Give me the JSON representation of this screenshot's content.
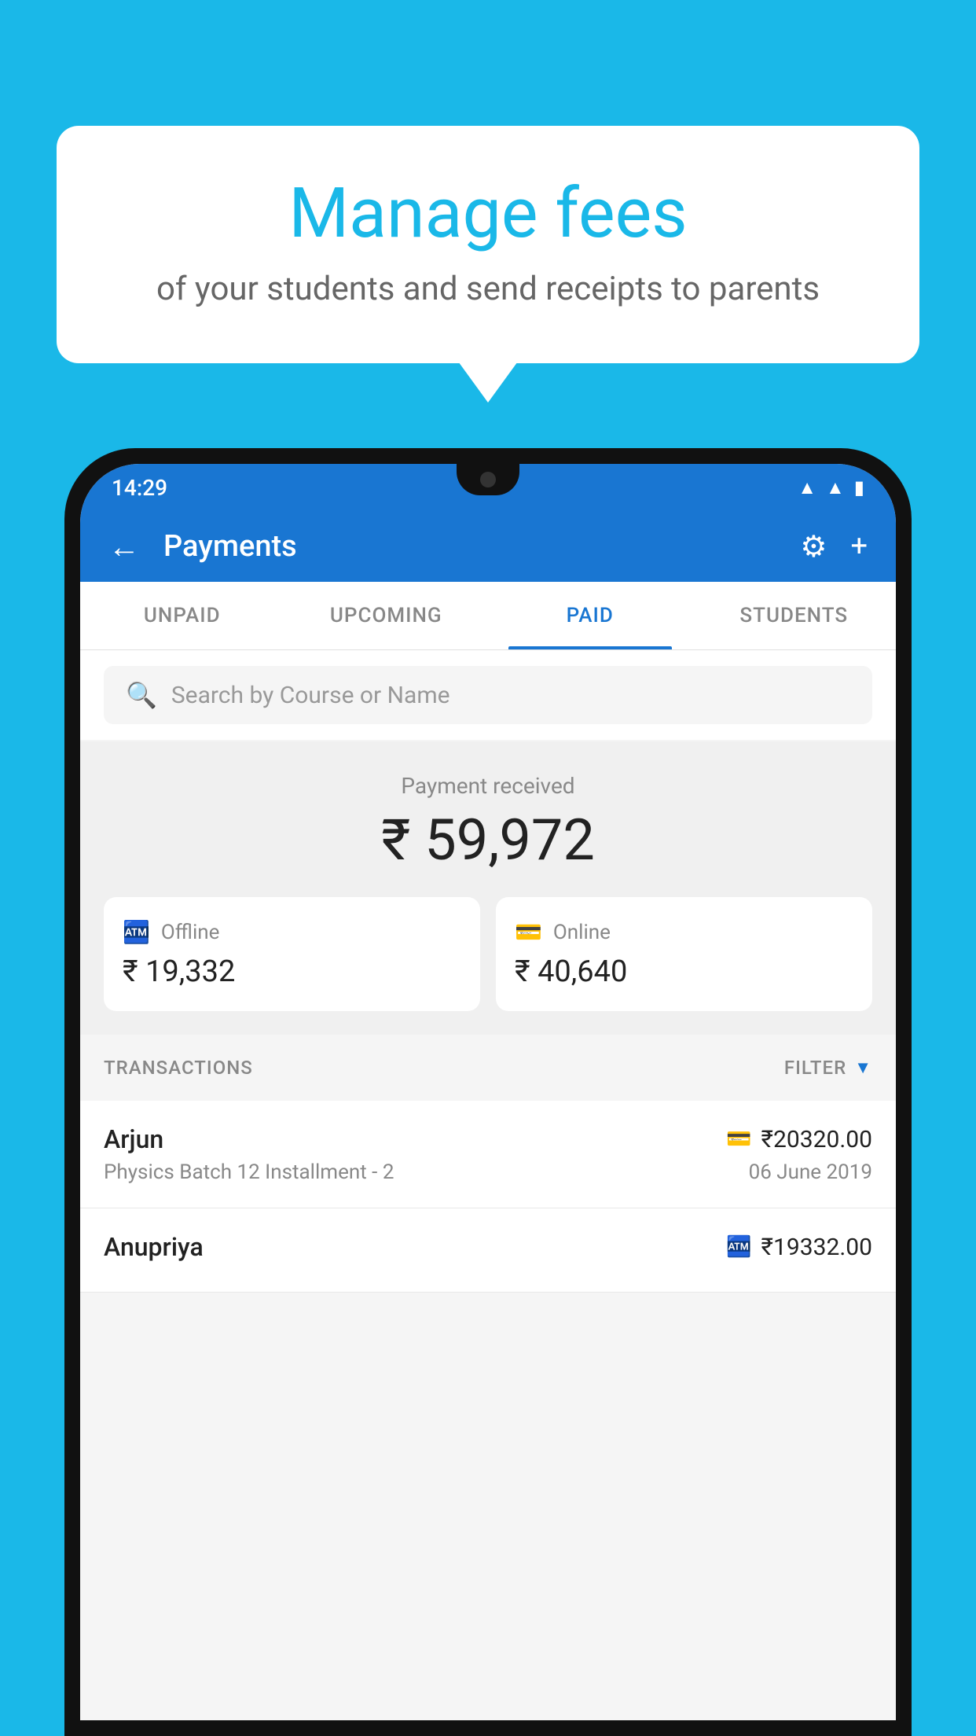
{
  "background_color": "#1ab8e8",
  "speech_bubble": {
    "title": "Manage fees",
    "subtitle": "of your students and send receipts to parents"
  },
  "status_bar": {
    "time": "14:29",
    "wifi": "wifi",
    "signal": "signal",
    "battery": "battery"
  },
  "app_bar": {
    "title": "Payments",
    "back_label": "←",
    "settings_label": "⚙",
    "add_label": "+"
  },
  "tabs": [
    {
      "label": "UNPAID",
      "active": false
    },
    {
      "label": "UPCOMING",
      "active": false
    },
    {
      "label": "PAID",
      "active": true
    },
    {
      "label": "STUDENTS",
      "active": false
    }
  ],
  "search": {
    "placeholder": "Search by Course or Name"
  },
  "payment_received": {
    "label": "Payment received",
    "amount": "₹ 59,972",
    "offline": {
      "icon": "offline-payment-icon",
      "label": "Offline",
      "amount": "₹ 19,332"
    },
    "online": {
      "icon": "online-payment-icon",
      "label": "Online",
      "amount": "₹ 40,640"
    }
  },
  "transactions_section": {
    "label": "TRANSACTIONS",
    "filter_label": "FILTER"
  },
  "transactions": [
    {
      "name": "Arjun",
      "course": "Physics Batch 12 Installment - 2",
      "amount": "₹20320.00",
      "date": "06 June 2019",
      "payment_type": "card"
    },
    {
      "name": "Anupriya",
      "course": "",
      "amount": "₹19332.00",
      "date": "",
      "payment_type": "offline"
    }
  ]
}
